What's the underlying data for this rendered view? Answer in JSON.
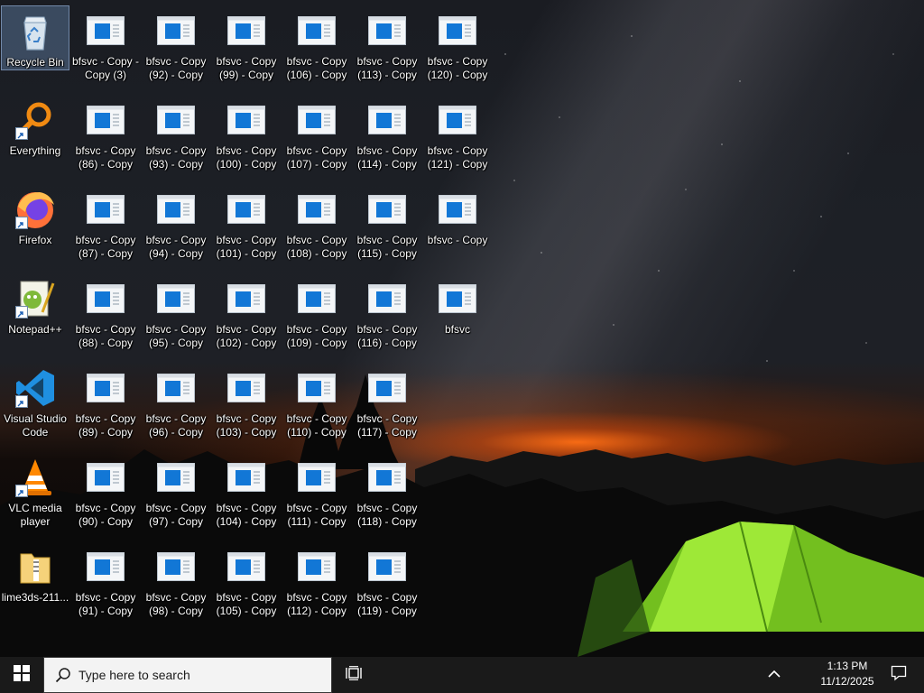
{
  "desktop": {
    "system_icons": [
      {
        "label": "Recycle Bin",
        "icon": "recycle-bin-icon",
        "name": "recycle-bin"
      },
      {
        "label": "Everything",
        "icon": "everything-search-icon",
        "name": "everything"
      },
      {
        "label": "Firefox",
        "icon": "firefox-icon",
        "name": "firefox"
      },
      {
        "label": "Notepad++",
        "icon": "notepadpp-icon",
        "name": "notepadpp"
      },
      {
        "label": "Visual Studio Code",
        "icon": "vscode-icon",
        "name": "vscode"
      },
      {
        "label": "VLC media player",
        "icon": "vlc-icon",
        "name": "vlc"
      },
      {
        "label": "lime3ds-211...",
        "icon": "zip-folder-icon",
        "name": "lime3ds"
      }
    ],
    "file_columns": [
      [
        "bfsvc - Copy - Copy (3)",
        "bfsvc - Copy (86) - Copy",
        "bfsvc - Copy (87) - Copy",
        "bfsvc - Copy (88) - Copy",
        "bfsvc - Copy (89) - Copy",
        "bfsvc - Copy (90) - Copy",
        "bfsvc - Copy (91) - Copy"
      ],
      [
        "bfsvc - Copy (92) - Copy",
        "bfsvc - Copy (93) - Copy",
        "bfsvc - Copy (94) - Copy",
        "bfsvc - Copy (95) - Copy",
        "bfsvc - Copy (96) - Copy",
        "bfsvc - Copy (97) - Copy",
        "bfsvc - Copy (98) - Copy"
      ],
      [
        "bfsvc - Copy (99) - Copy",
        "bfsvc - Copy (100) - Copy",
        "bfsvc - Copy (101) - Copy",
        "bfsvc - Copy (102) - Copy",
        "bfsvc - Copy (103) - Copy",
        "bfsvc - Copy (104) - Copy",
        "bfsvc - Copy (105) - Copy"
      ],
      [
        "bfsvc - Copy (106) - Copy",
        "bfsvc - Copy (107) - Copy",
        "bfsvc - Copy (108) - Copy",
        "bfsvc - Copy (109) - Copy",
        "bfsvc - Copy (110) - Copy",
        "bfsvc - Copy (111) - Copy",
        "bfsvc - Copy (112) - Copy"
      ],
      [
        "bfsvc - Copy (113) - Copy",
        "bfsvc - Copy (114) - Copy",
        "bfsvc - Copy (115) - Copy",
        "bfsvc - Copy (116) - Copy",
        "bfsvc - Copy (117) - Copy",
        "bfsvc - Copy (118) - Copy",
        "bfsvc - Copy (119) - Copy"
      ],
      [
        "bfsvc - Copy (120) - Copy",
        "bfsvc - Copy (121) - Copy",
        "bfsvc - Copy",
        "bfsvc"
      ]
    ],
    "file_icon": "application-window-icon"
  },
  "taskbar": {
    "start_icon": "windows-logo-icon",
    "search_placeholder": "Type here to search",
    "task_view_icon": "task-view-icon",
    "tray_chevron_icon": "chevron-up-icon",
    "time": "1:13 PM",
    "date": "11/12/2025",
    "notification_icon": "notification-icon"
  },
  "colors": {
    "taskbar_bg": "#1a1a1a",
    "search_bg": "#f3f3f3",
    "file_icon_blue": "#1277d6",
    "tent_green": "#7ed321"
  }
}
